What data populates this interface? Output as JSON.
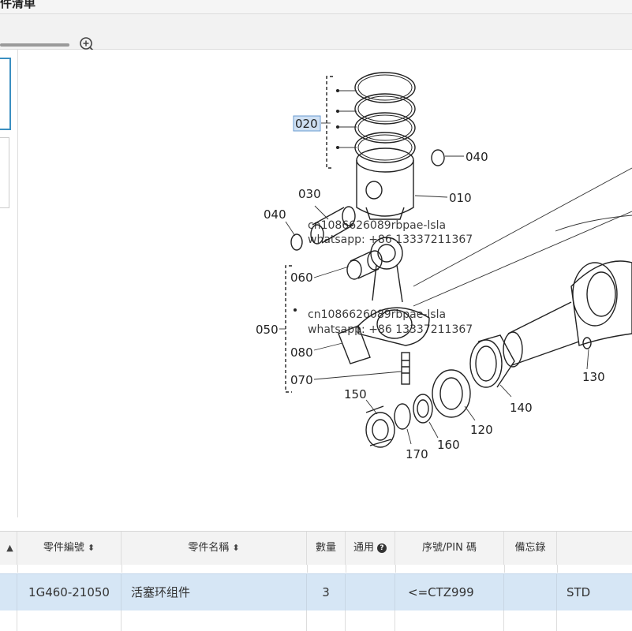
{
  "header": {
    "title": "件清单"
  },
  "diagram": {
    "callouts": [
      "020",
      "040",
      "030",
      "010",
      "040",
      "060",
      "050",
      "080",
      "070",
      "150",
      "170",
      "160",
      "120",
      "140",
      "130"
    ],
    "watermark": [
      "cn1086626089rbpae-lsla",
      "whatsapp: +86 13337211367",
      "cn1086626089rbpae-lsla",
      "whatsapp: +86 13337211367"
    ]
  },
  "table": {
    "columns": [
      "零件編號",
      "零件名稱",
      "數量",
      "通用",
      "序號/PIN 碼",
      "備忘錄"
    ],
    "row": {
      "part_number": "1G460-21050",
      "part_name": "活塞环组件",
      "quantity": "3",
      "serial": "<=CTZ999",
      "memo": "STD"
    }
  }
}
